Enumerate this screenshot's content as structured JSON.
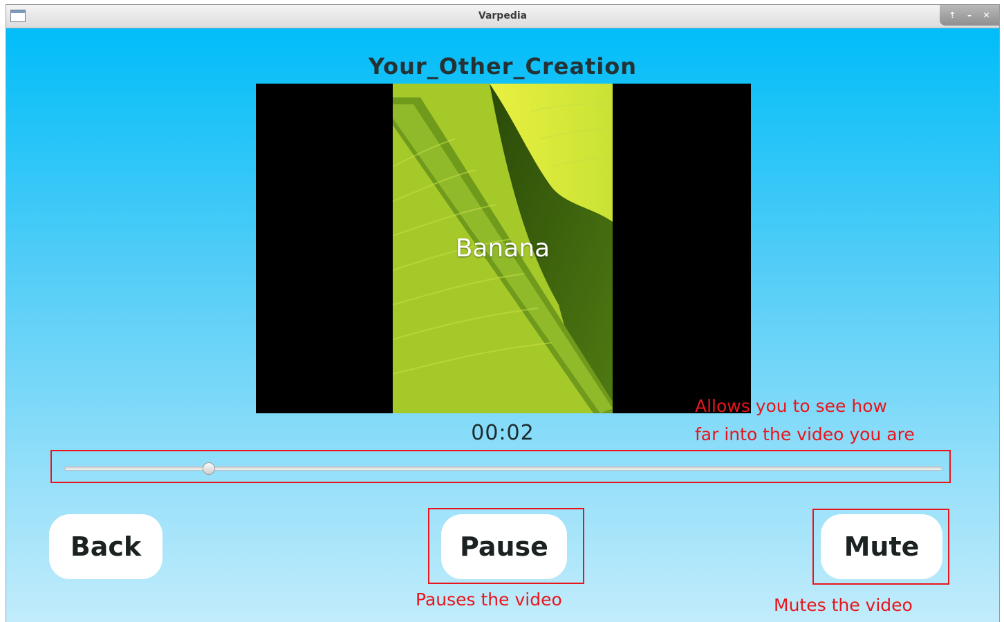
{
  "window": {
    "title": "Varpedia",
    "controls": [
      "⇡",
      "–",
      "✕"
    ]
  },
  "player": {
    "title": "Your_Other_Creation",
    "caption": "Banana",
    "time": "00:02",
    "progress": 0.164
  },
  "buttons": {
    "back": "Back",
    "pause": "Pause",
    "mute": "Mute"
  },
  "annotations": {
    "slider_line1": "Allows you to see how",
    "slider_line2": "far into the video you are",
    "pause": "Pauses the video",
    "mute": "Mutes the video"
  },
  "colors": {
    "annotation": "#e8151b",
    "background_top": "#01bdf9",
    "background_bottom": "#c2ecfb"
  }
}
